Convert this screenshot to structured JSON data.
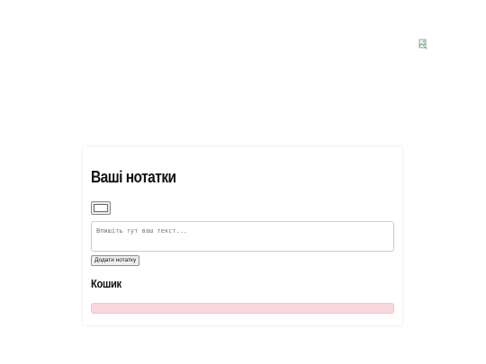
{
  "page": {
    "broken_image_icon": "broken-image-icon"
  },
  "notes": {
    "title": "Ваші нотатки",
    "color_value": "#ffffff",
    "textarea_placeholder": "Впишіть тут ваш текст...",
    "textarea_value": "",
    "add_button_label": "Додати нотатку"
  },
  "trash": {
    "title": "Кошик",
    "zone_color": "#f9d7dc"
  }
}
